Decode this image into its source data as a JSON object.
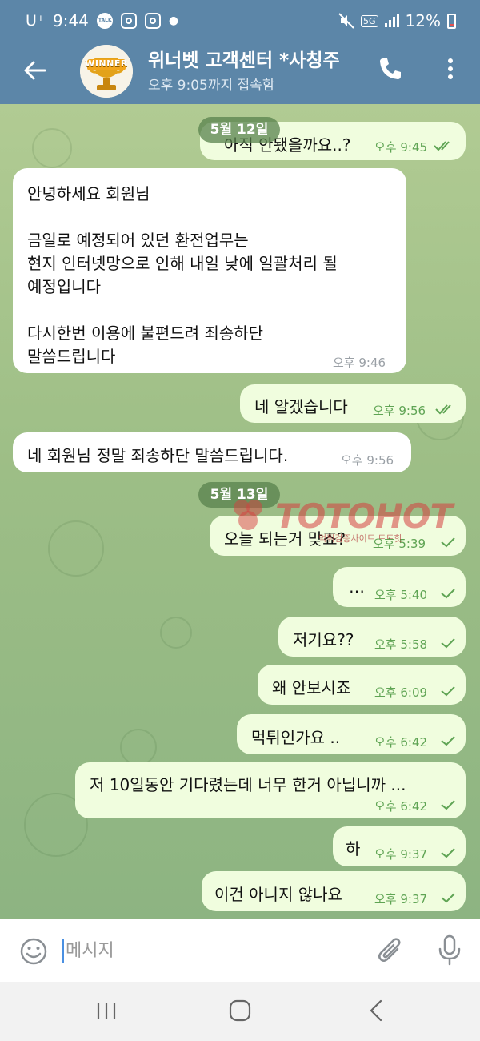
{
  "status_bar": {
    "carrier": "U⁺",
    "time": "9:44",
    "network": "5G",
    "battery": "12%",
    "icons": [
      "kakaotalk-icon",
      "instagram-icon",
      "instagram-icon",
      "notification-dot",
      "mute-icon",
      "signal-icon",
      "battery-icon"
    ]
  },
  "header": {
    "title": "위너벳 고객센터 *사칭주",
    "subtitle": "오후 9:05까지 접속함",
    "avatar_label": "WINNER"
  },
  "chat": {
    "date_labels": [
      "5월 12일",
      "5월 13일"
    ],
    "messages": [
      {
        "dir": "out",
        "text": "아직 안됐을까요..?",
        "time": "오후 9:45",
        "read": true
      },
      {
        "dir": "in",
        "lines": [
          "안녕하세요 회원님",
          "",
          "금일로 예정되어 있던 환전업무는",
          "현지 인터넷망으로 인해 내일 낮에 일괄처리 될",
          "예정입니다",
          "",
          "다시한번 이용에 불편드려 죄송하단",
          "말씀드립니다"
        ],
        "time": "오후 9:46"
      },
      {
        "dir": "out",
        "text": "네 알겠습니다",
        "time": "오후 9:56",
        "read": true
      },
      {
        "dir": "in",
        "text": "네 회원님 정말 죄송하단 말씀드립니다.",
        "time": "오후 9:56"
      },
      {
        "dir": "out",
        "text": "오늘 되는거 맞죠?",
        "time": "오후 5:39",
        "read": false
      },
      {
        "dir": "out",
        "text": "…",
        "time": "오후 5:40",
        "read": false
      },
      {
        "dir": "out",
        "text": "저기요??",
        "time": "오후 5:58",
        "read": false
      },
      {
        "dir": "out",
        "text": "왜 안보시죠",
        "time": "오후 6:09",
        "read": false
      },
      {
        "dir": "out",
        "text": "먹튀인가요 ..",
        "time": "오후 6:42",
        "read": false
      },
      {
        "dir": "out",
        "text": "저 10일동안 기다렸는데 너무 한거 아닙니까 ...",
        "time": "오후 6:42",
        "read": false
      },
      {
        "dir": "out",
        "text": "하",
        "time": "오후 9:37",
        "read": false
      },
      {
        "dir": "out",
        "text": "이건 아니지 않나요",
        "time": "오후 9:37",
        "read": false
      }
    ]
  },
  "watermark": {
    "text": "TOTOHOT",
    "sub": "먹튀검증사이트 토토핫"
  },
  "input": {
    "placeholder": "메시지"
  },
  "colors": {
    "header_bg": "#5c86a8",
    "outgoing_bubble": "#f0fdde",
    "incoming_bubble": "#ffffff",
    "outgoing_time": "#5fa454",
    "date_pill": "#6a9460"
  }
}
